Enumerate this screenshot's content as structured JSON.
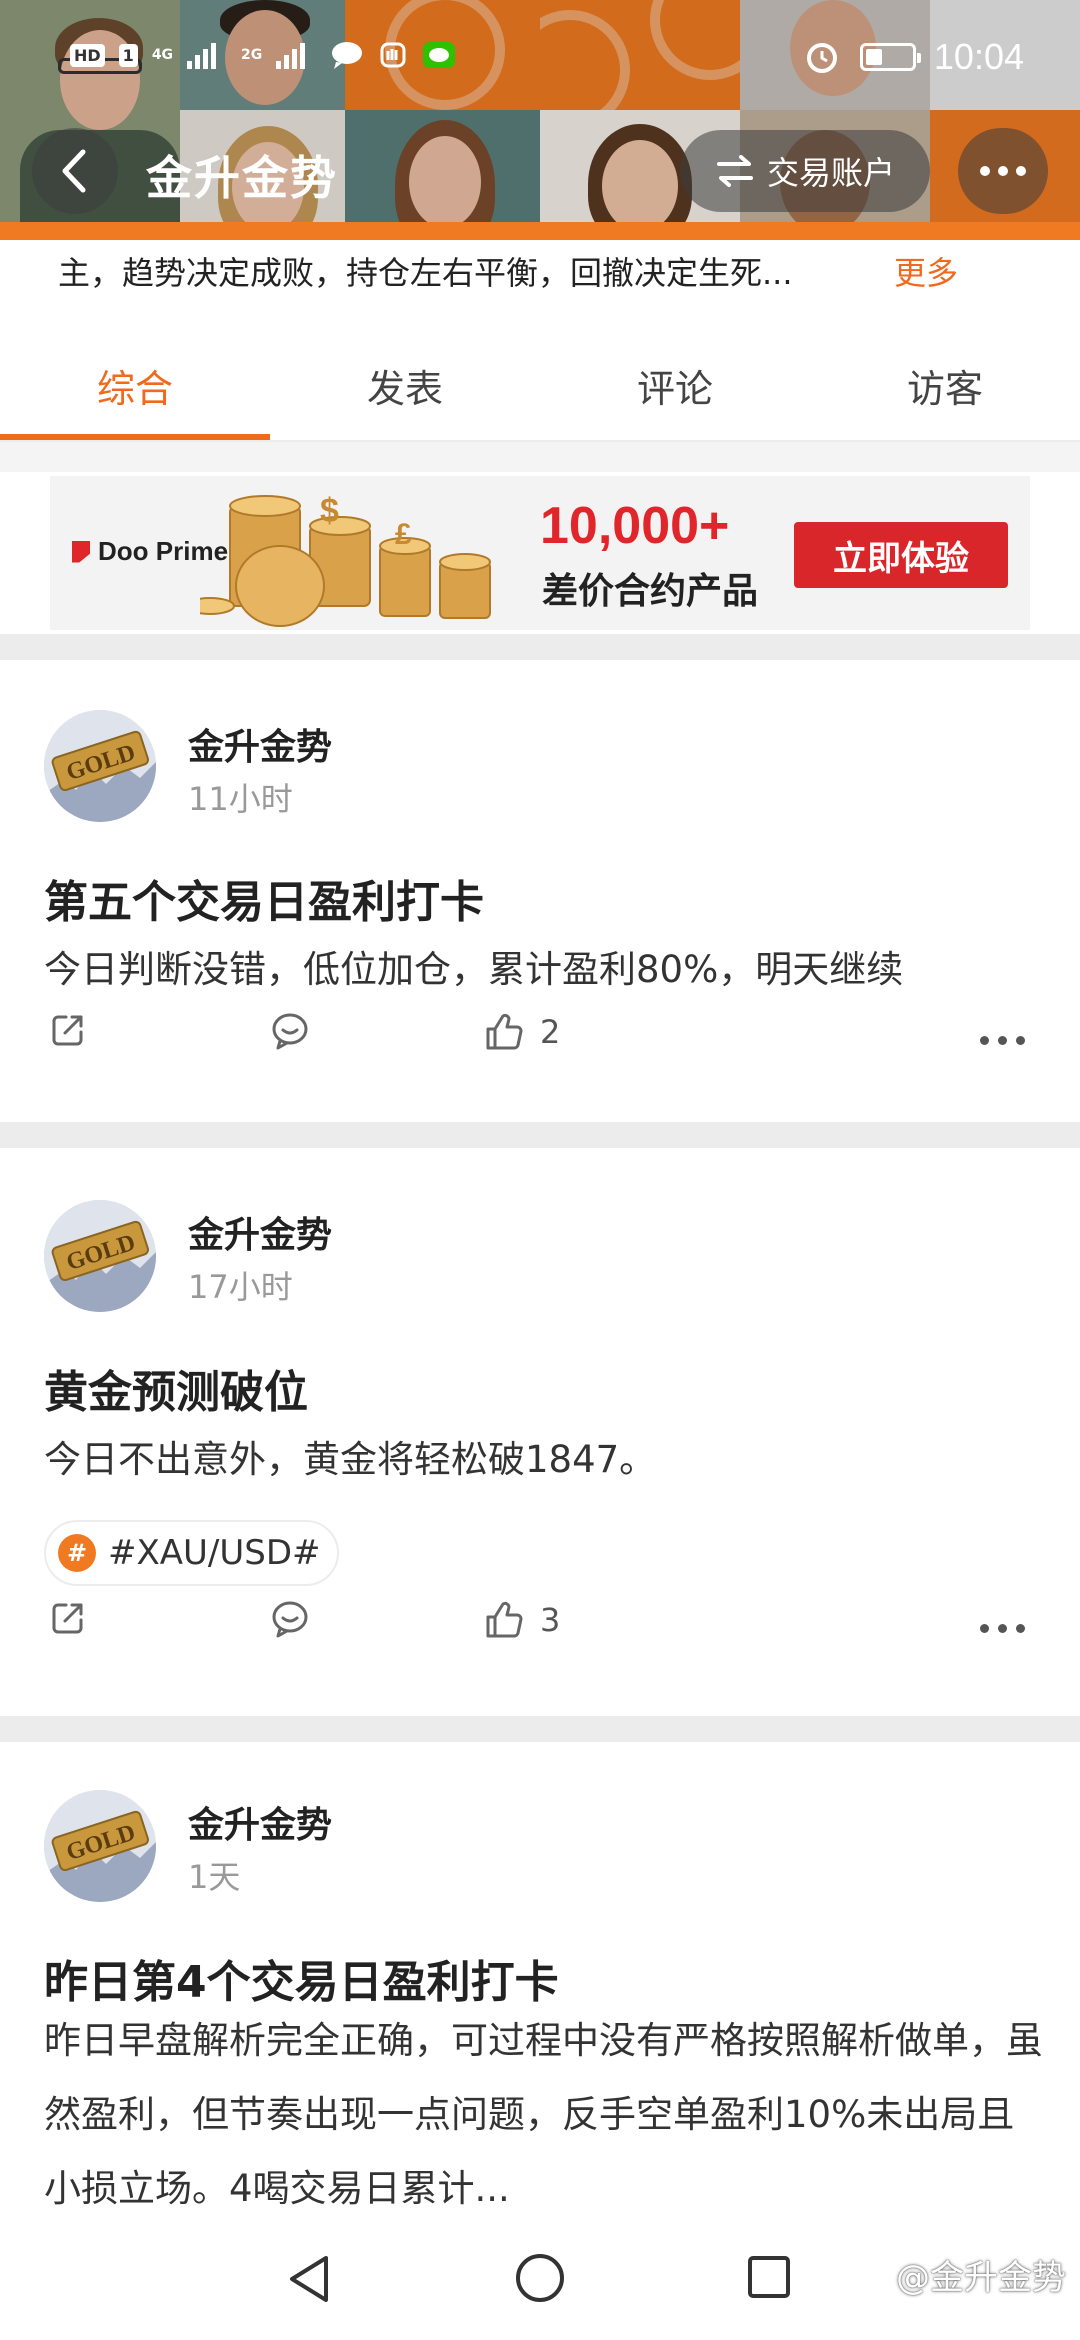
{
  "status_bar": {
    "left_chips": [
      "HD",
      "1"
    ],
    "network_1": "4G",
    "network_2": "2G",
    "time": "10:04"
  },
  "header": {
    "title": "金升金势",
    "account_button": "交易账户"
  },
  "intro": {
    "text": "主，趋势决定成败，持仓左右平衡，回撤决定生死...",
    "more": "更多"
  },
  "tabs": [
    {
      "label": "综合",
      "active": true
    },
    {
      "label": "发表",
      "active": false
    },
    {
      "label": "评论",
      "active": false
    },
    {
      "label": "访客",
      "active": false
    }
  ],
  "banner": {
    "brand": "Doo Prime",
    "headline": "10,000+",
    "subline": "差价合约产品",
    "cta": "立即体验"
  },
  "posts": [
    {
      "author": "金升金势",
      "time": "11小时",
      "title": "第五个交易日盈利打卡",
      "body": "今日判断没错，低位加仓，累计盈利80%，明天继续",
      "likes": "2"
    },
    {
      "author": "金升金势",
      "time": "17小时",
      "title": "黄金预测破位",
      "body": "今日不出意外，黄金将轻松破1847。",
      "tag": "#XAU/USD#",
      "likes": "3"
    },
    {
      "author": "金升金势",
      "time": "1天",
      "title": "昨日第4个交易日盈利打卡",
      "body": "昨日早盘解析完全正确，可过程中没有严格按照解析做单，虽然盈利，但节奏出现一点问题，反手空单盈利10%未出局且小损立场。4喝交易日累计..."
    }
  ],
  "avatar_label": "GOLD",
  "watermark": "@金升金势",
  "colors": {
    "accent": "#f06a1e",
    "banner_red": "#e0262b",
    "separator": "#ececec"
  },
  "icons": [
    "back-icon",
    "swap-icon",
    "more-icon",
    "share-icon",
    "comment-icon",
    "like-icon",
    "hash-icon",
    "nav-back-icon",
    "nav-home-icon",
    "nav-recents-icon"
  ]
}
